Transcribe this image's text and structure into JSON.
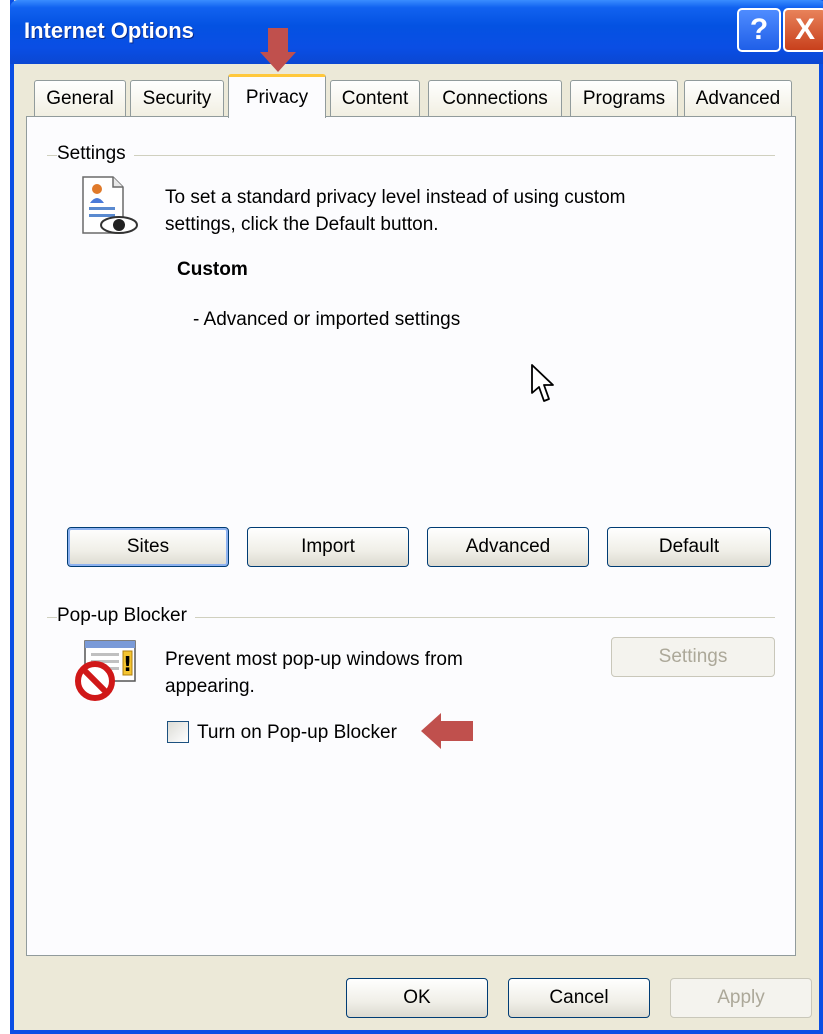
{
  "window": {
    "title": "Internet Options"
  },
  "titlebar_buttons": {
    "help": "?",
    "close": "X"
  },
  "tabs": [
    {
      "label": "General"
    },
    {
      "label": "Security"
    },
    {
      "label": "Privacy",
      "active": true
    },
    {
      "label": "Content"
    },
    {
      "label": "Connections"
    },
    {
      "label": "Programs"
    },
    {
      "label": "Advanced"
    }
  ],
  "settings": {
    "group_label": "Settings",
    "description_line1": "To set a standard privacy level instead of using custom",
    "description_line2": "settings, click the Default button.",
    "level_name": "Custom",
    "level_detail": "- Advanced or imported settings",
    "buttons": {
      "sites": "Sites",
      "import": "Import",
      "advanced": "Advanced",
      "default": "Default"
    }
  },
  "popup_blocker": {
    "group_label": "Pop-up Blocker",
    "description_line1": "Prevent most pop-up windows from",
    "description_line2": "appearing.",
    "settings_button": "Settings",
    "checkbox_label": "Turn on Pop-up Blocker",
    "checkbox_checked": false
  },
  "footer": {
    "ok": "OK",
    "cancel": "Cancel",
    "apply": "Apply"
  },
  "colors": {
    "annotation_arrow": "#c0504d",
    "titlebar": "#0a4ee4"
  }
}
